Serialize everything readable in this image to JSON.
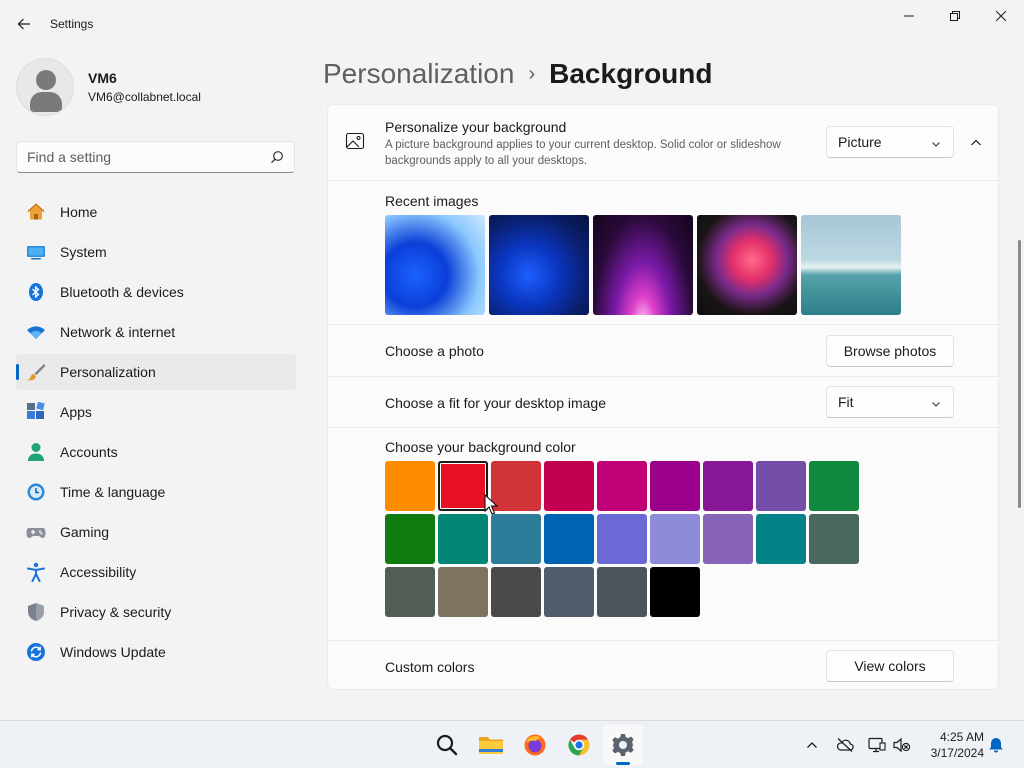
{
  "window": {
    "title": "Settings"
  },
  "profile": {
    "name": "VM6",
    "email": "VM6@collabnet.local"
  },
  "search": {
    "placeholder": "Find a setting",
    "value": ""
  },
  "sidebar": {
    "items": [
      {
        "label": "Home",
        "icon": "home-icon",
        "active": false
      },
      {
        "label": "System",
        "icon": "system-icon",
        "active": false
      },
      {
        "label": "Bluetooth & devices",
        "icon": "bluetooth-icon",
        "active": false
      },
      {
        "label": "Network & internet",
        "icon": "network-icon",
        "active": false
      },
      {
        "label": "Personalization",
        "icon": "brush-icon",
        "active": true
      },
      {
        "label": "Apps",
        "icon": "apps-icon",
        "active": false
      },
      {
        "label": "Accounts",
        "icon": "accounts-icon",
        "active": false
      },
      {
        "label": "Time & language",
        "icon": "time-language-icon",
        "active": false
      },
      {
        "label": "Gaming",
        "icon": "gaming-icon",
        "active": false
      },
      {
        "label": "Accessibility",
        "icon": "accessibility-icon",
        "active": false
      },
      {
        "label": "Privacy & security",
        "icon": "shield-icon",
        "active": false
      },
      {
        "label": "Windows Update",
        "icon": "update-icon",
        "active": false
      }
    ]
  },
  "breadcrumb": {
    "parent": "Personalization",
    "separator": "›",
    "current": "Background"
  },
  "background": {
    "title": "Personalize your background",
    "description": "A picture background applies to your current desktop. Solid color or slideshow backgrounds apply to all your desktops.",
    "type_value": "Picture",
    "recent_label": "Recent images",
    "recent_images": [
      "wallpaper-bloom-light",
      "wallpaper-bloom-dark",
      "wallpaper-glow-purple",
      "wallpaper-abstract-flower",
      "wallpaper-lake"
    ],
    "photo_label": "Choose a photo",
    "browse_label": "Browse photos",
    "fit_label": "Choose a fit for your desktop image",
    "fit_value": "Fit",
    "color_label": "Choose your background color",
    "selected_color_index": 1,
    "colors": [
      "#ff8c00",
      "#e81123",
      "#d13438",
      "#c30052",
      "#bf0077",
      "#9a0089",
      "#881798",
      "#744da9",
      "#10893e",
      "#107c10",
      "#018574",
      "#2d7d9a",
      "#0063b1",
      "#6b69d6",
      "#8e8cd8",
      "#8764b8",
      "#038387",
      "#486860",
      "#525e54",
      "#7e735f",
      "#4c4a48",
      "#515c6b",
      "#4a5459",
      "#000000"
    ],
    "custom_label": "Custom colors",
    "view_colors_label": "View colors"
  },
  "taskbar": {
    "apps": [
      "search-icon",
      "file-explorer-icon",
      "firefox-icon",
      "chrome-icon",
      "settings-icon"
    ],
    "active_app": "settings-icon",
    "time": "4:25 AM",
    "date": "3/17/2024"
  }
}
